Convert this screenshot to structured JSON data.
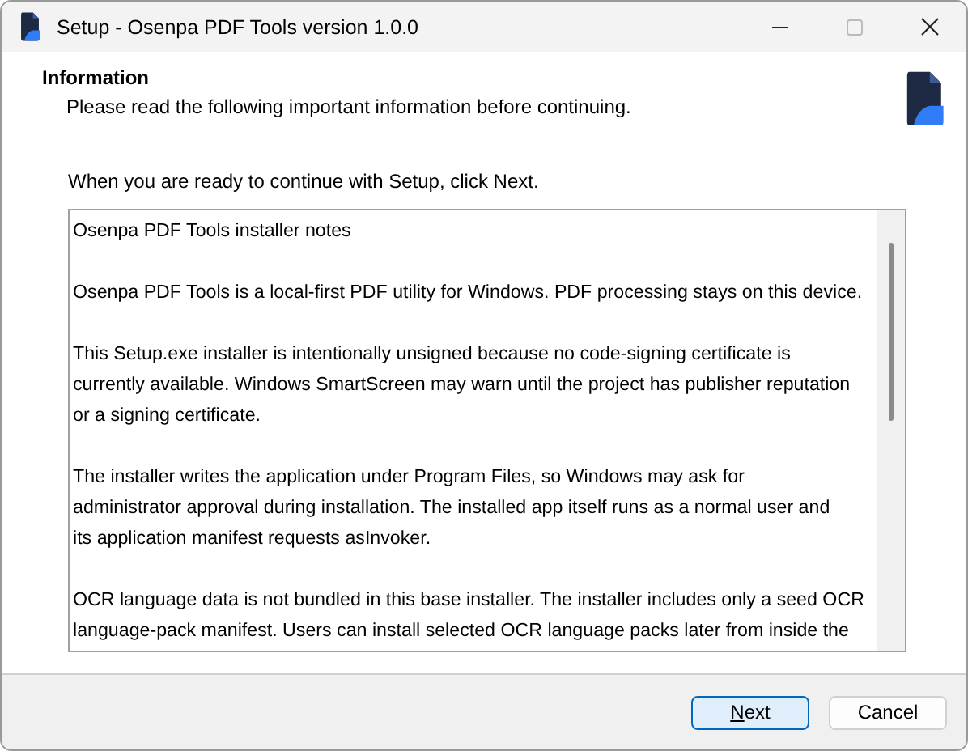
{
  "window": {
    "title": "Setup - Osenpa PDF Tools version 1.0.0"
  },
  "header": {
    "title": "Information",
    "subtitle": "Please read the following important information before continuing."
  },
  "instruction": "When you are ready to continue with Setup, click Next.",
  "notes": [
    {
      "lines": [
        "Osenpa PDF Tools installer notes"
      ]
    },
    {
      "lines": [
        "Osenpa PDF Tools is a local-first PDF utility for Windows. PDF processing stays on this device."
      ]
    },
    {
      "lines": [
        "This Setup.exe installer is intentionally unsigned because no code-signing certificate is",
        "currently available. Windows SmartScreen may warn until the project has publisher reputation",
        "or a signing certificate."
      ]
    },
    {
      "lines": [
        "The installer writes the application under Program Files, so Windows may ask for",
        "administrator approval during installation. The installed app itself runs as a normal user and",
        "its application manifest requests asInvoker."
      ]
    },
    {
      "lines": [
        "OCR language data is not bundled in this base installer. The installer includes only a seed OCR",
        "language-pack manifest. Users can install selected OCR language packs later from inside the"
      ]
    }
  ],
  "buttons": [
    {
      "label": "Next",
      "default": true,
      "first_letter_underlined": true
    },
    {
      "label": "Cancel",
      "default": false
    }
  ]
}
